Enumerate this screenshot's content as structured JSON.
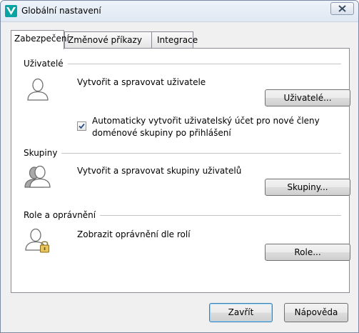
{
  "window": {
    "title": "Globální nastavení"
  },
  "tabs": [
    {
      "label": "Zabezpečení",
      "active": true
    },
    {
      "label": "Změnové příkazy",
      "active": false
    },
    {
      "label": "Integrace",
      "active": false
    }
  ],
  "sections": {
    "users": {
      "title": "Uživatelé",
      "description": "Vytvořit a spravovat uživatele",
      "button": "Uživatelé...",
      "icon": "user-icon",
      "checkbox": {
        "checked": true,
        "label": "Automaticky vytvořit uživatelský účet pro nové členy doménové skupiny po přihlášení"
      }
    },
    "groups": {
      "title": "Skupiny",
      "description": "Vytvořit a spravovat skupiny uživatelů",
      "button": "Skupiny...",
      "icon": "user-group-icon"
    },
    "roles": {
      "title": "Role a oprávnění",
      "description": "Zobrazit oprávnění dle rolí",
      "button": "Role...",
      "icon": "user-lock-icon"
    }
  },
  "footer": {
    "close": "Zavřít",
    "help": "Nápověda"
  },
  "colors": {
    "app_icon": "#0aa3a3",
    "default_button_border": "#3c7fb1"
  }
}
